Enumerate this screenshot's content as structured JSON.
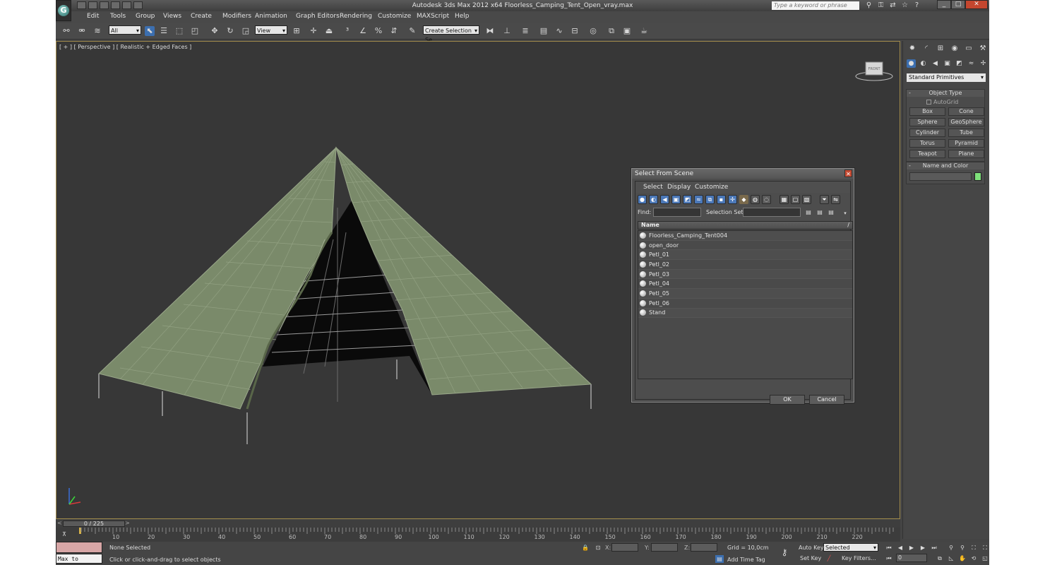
{
  "window": {
    "title": "Autodesk 3ds Max  2012 x64      Floorless_Camping_Tent_Open_vray.max",
    "search_placeholder": "Type a keyword or phrase",
    "app_logo": "G"
  },
  "menu": [
    "Edit",
    "Tools",
    "Group",
    "Views",
    "Create",
    "Modifiers",
    "Animation",
    "Graph Editors",
    "Rendering",
    "Customize",
    "MAXScript",
    "Help"
  ],
  "toolbar": {
    "selection_filter": "All",
    "reference_coord": "View",
    "named_selection_placeholder": "Create Selection Se"
  },
  "viewport": {
    "label": "[ + ] [ Perspective ] [ Realistic + Edged Faces ]",
    "viewcube_face": "FRONT"
  },
  "command_panel": {
    "category": "Standard Primitives",
    "object_type_title": "Object Type",
    "autogrid_label": "AutoGrid",
    "primitives": [
      "Box",
      "Cone",
      "Sphere",
      "GeoSphere",
      "Cylinder",
      "Tube",
      "Torus",
      "Pyramid",
      "Teapot",
      "Plane"
    ],
    "name_color_title": "Name and Color",
    "object_color": "#7ee07a"
  },
  "timeslider": {
    "frame_display": "0 / 225",
    "left_arrow": "<",
    "right_arrow": ">"
  },
  "trackbar_ticks": [
    "10",
    "20",
    "30",
    "40",
    "50",
    "60",
    "70",
    "80",
    "90",
    "100",
    "110",
    "120",
    "130",
    "140",
    "150",
    "160",
    "170",
    "180",
    "190",
    "200",
    "210",
    "220"
  ],
  "statusbar": {
    "listener_label": "Max to Physc.",
    "selection_status": "None Selected",
    "prompt": "Click or click-and-drag to select objects",
    "x_label": "X:",
    "y_label": "Y:",
    "z_label": "Z:",
    "grid": "Grid = 10,0cm",
    "add_time_tag": "Add Time Tag",
    "auto_key": "Auto Key",
    "set_key": "Set Key",
    "key_mode": "Selected",
    "key_filters": "Key Filters...",
    "current_frame": "0"
  },
  "dialog": {
    "title": "Select From Scene",
    "menu": [
      "Select",
      "Display",
      "Customize"
    ],
    "find_label": "Find:",
    "selection_set_label": "Selection Set:",
    "column_header": "Name",
    "sort_indicator": "/",
    "objects": [
      "Floorless_Camping_Tent004",
      "open_door",
      "Petl_01",
      "Petl_02",
      "Petl_03",
      "Petl_04",
      "Petl_05",
      "Petl_06",
      "Stand"
    ],
    "ok": "OK",
    "cancel": "Cancel"
  },
  "colors": {
    "viewport_bg": "#373737",
    "tent_fabric": "#7a8a6a",
    "active_border": "#a08a4a"
  }
}
